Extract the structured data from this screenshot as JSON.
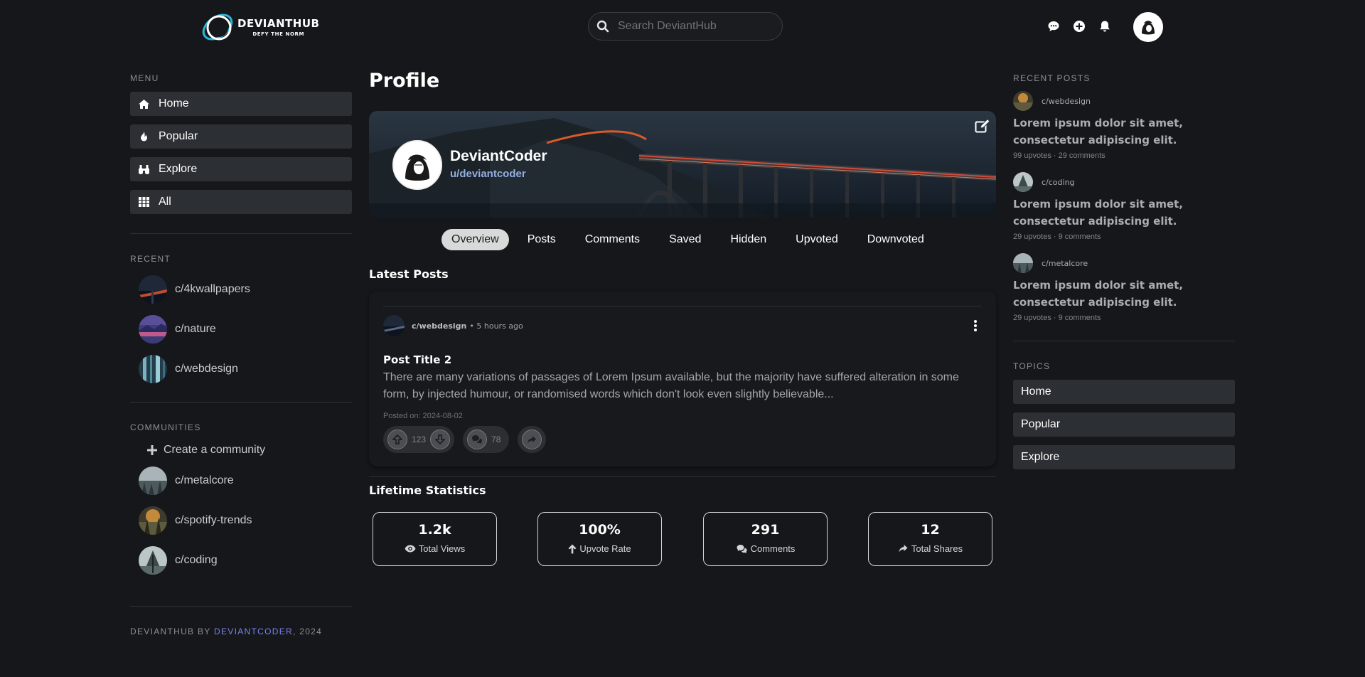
{
  "brand": {
    "name": "DEVIANTHUB",
    "tagline": "DEFY THE NORM"
  },
  "header": {
    "search_placeholder": "Search DeviantHub",
    "icons": [
      "chat-icon",
      "plus-circle-icon",
      "bell-icon",
      "user-avatar"
    ]
  },
  "left_sidebar": {
    "menu_title": "MENU",
    "menu": [
      {
        "label": "Home",
        "icon": "home-icon"
      },
      {
        "label": "Popular",
        "icon": "fire-icon"
      },
      {
        "label": "Explore",
        "icon": "binoculars-icon"
      },
      {
        "label": "All",
        "icon": "grid-icon"
      }
    ],
    "recent_title": "RECENT",
    "recent": [
      {
        "label": "c/4kwallpapers"
      },
      {
        "label": "c/nature"
      },
      {
        "label": "c/webdesign"
      }
    ],
    "communities_title": "COMMUNITIES",
    "create_label": "Create a community",
    "communities": [
      {
        "label": "c/metalcore"
      },
      {
        "label": "c/spotify-trends"
      },
      {
        "label": "c/coding"
      }
    ],
    "footer_prefix": "DEVIANTHUB BY",
    "footer_author": "DEVIANTCODER",
    "footer_year": ", 2024"
  },
  "main": {
    "page_title": "Profile",
    "profile": {
      "display_name": "DeviantCoder",
      "username": "u/deviantcoder"
    },
    "tabs": [
      {
        "label": "Overview",
        "active": true
      },
      {
        "label": "Posts"
      },
      {
        "label": "Comments"
      },
      {
        "label": "Saved"
      },
      {
        "label": "Hidden"
      },
      {
        "label": "Upvoted"
      },
      {
        "label": "Downvoted"
      }
    ],
    "latest_posts_title": "Latest Posts",
    "post": {
      "community": "c/webdesign",
      "time": "• 5 hours ago",
      "title": "Post Title 2",
      "body": "There are many variations of passages of Lorem Ipsum available, but the majority have suffered alteration in some form, by injected humour, or randomised words which don't look even slightly believable...",
      "posted_on": "Posted on: 2024-08-02",
      "votes": "123",
      "comments": "78"
    },
    "stats_title": "Lifetime Statistics",
    "stats": [
      {
        "value": "1.2k",
        "label": "Total Views",
        "icon": "eye-icon"
      },
      {
        "value": "100%",
        "label": "Upvote Rate",
        "icon": "arrow-up-icon"
      },
      {
        "value": "291",
        "label": "Comments",
        "icon": "comments-icon"
      },
      {
        "value": "12",
        "label": "Total Shares",
        "icon": "share-icon"
      }
    ]
  },
  "right_sidebar": {
    "recent_posts_title": "RECENT POSTS",
    "recent_posts": [
      {
        "community": "c/webdesign",
        "title": "Lorem ipsum dolor sit amet, consectetur adipiscing elit.",
        "stats": "99 upvotes · 29 comments"
      },
      {
        "community": "c/coding",
        "title": "Lorem ipsum dolor sit amet, consectetur adipiscing elit.",
        "stats": "29 upvotes · 9 comments"
      },
      {
        "community": "c/metalcore",
        "title": "Lorem ipsum dolor sit amet, consectetur adipiscing elit.",
        "stats": "29 upvotes · 9 comments"
      }
    ],
    "topics_title": "TOPICS",
    "topics": [
      {
        "label": "Home"
      },
      {
        "label": "Popular"
      },
      {
        "label": "Explore"
      }
    ]
  },
  "colors": {
    "background": "#16171b",
    "accent_link": "#7b83f0",
    "handle": "#93aee0",
    "logo_ring": "#29b6d9"
  }
}
